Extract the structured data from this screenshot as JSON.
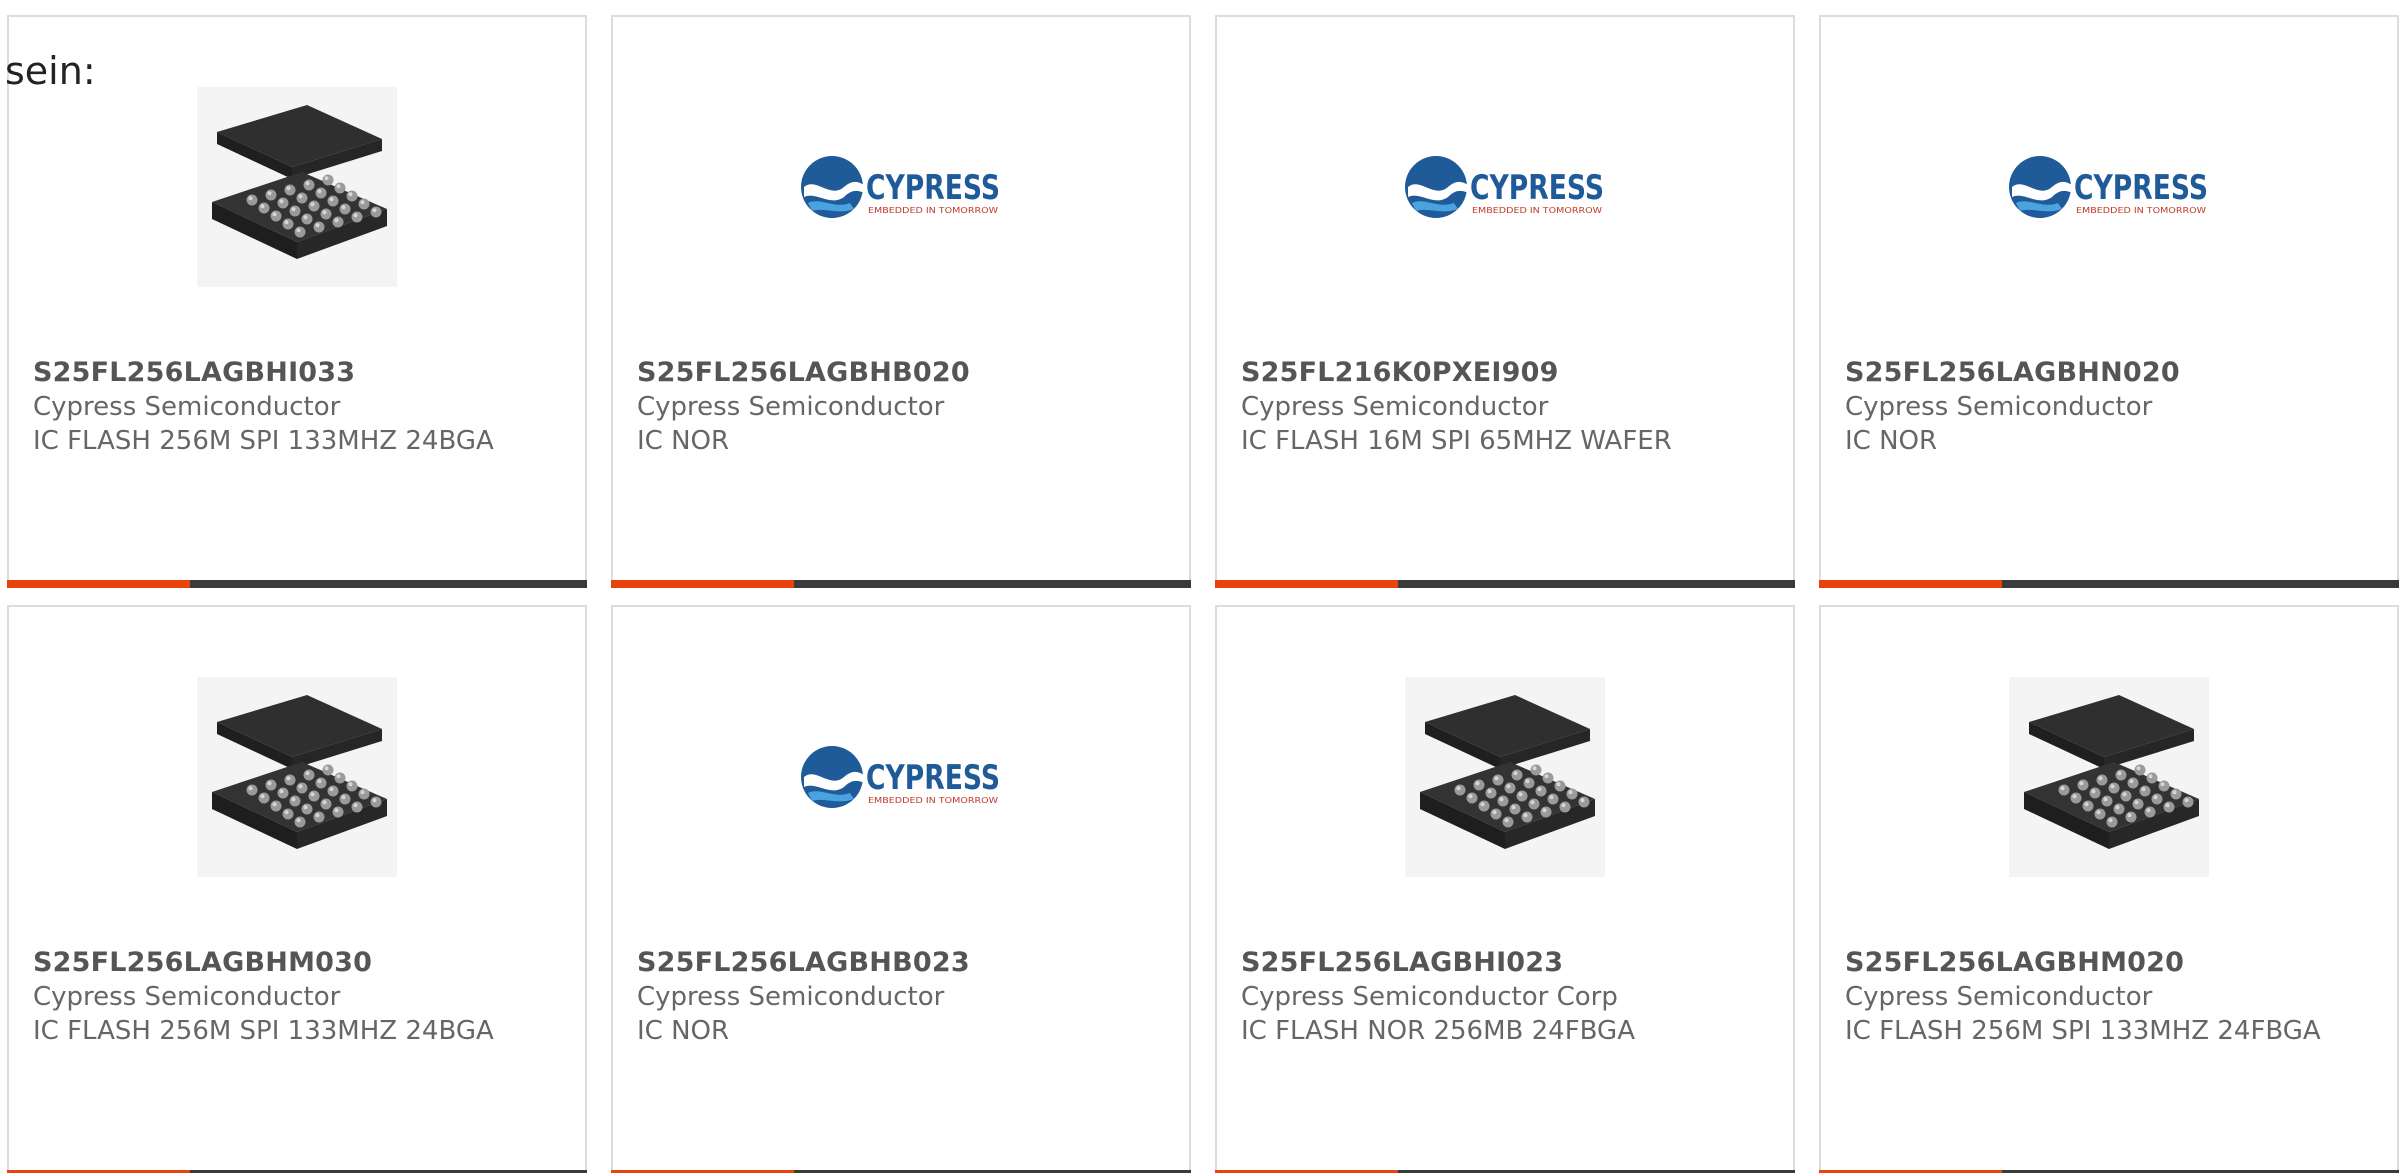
{
  "page": {
    "prefix_text": "sein:"
  },
  "colors": {
    "bar_accent": "#e8430c",
    "bar_rest": "#3a3a3a",
    "card_border": "#dcdcdc",
    "text_gray": "#666666",
    "cypress_blue": "#1f5a99"
  },
  "cards": [
    {
      "part_number": "S25FL256LAGBHI033",
      "manufacturer": "Cypress Semiconductor",
      "description": "IC FLASH 256M SPI 133MHZ 24BGA",
      "image_type": "chip-exploded"
    },
    {
      "part_number": "S25FL256LAGBHB020",
      "manufacturer": "Cypress Semiconductor",
      "description": "IC NOR",
      "image_type": "cypress-logo"
    },
    {
      "part_number": "S25FL216K0PXEI909",
      "manufacturer": "Cypress Semiconductor",
      "description": "IC FLASH 16M SPI 65MHZ WAFER",
      "image_type": "cypress-logo"
    },
    {
      "part_number": "S25FL256LAGBHN020",
      "manufacturer": "Cypress Semiconductor",
      "description": "IC NOR",
      "image_type": "cypress-logo"
    },
    {
      "part_number": "S25FL256LAGBHM030",
      "manufacturer": "Cypress Semiconductor",
      "description": "IC FLASH 256M SPI 133MHZ 24BGA",
      "image_type": "chip-exploded"
    },
    {
      "part_number": "S25FL256LAGBHB023",
      "manufacturer": "Cypress Semiconductor",
      "description": "IC NOR",
      "image_type": "cypress-logo"
    },
    {
      "part_number": "S25FL256LAGBHI023",
      "manufacturer": "Cypress Semiconductor Corp",
      "description": "IC FLASH NOR 256MB 24FBGA",
      "image_type": "chip-exploded"
    },
    {
      "part_number": "S25FL256LAGBHM020",
      "manufacturer": "Cypress Semiconductor",
      "description": "IC FLASH 256M SPI 133MHZ 24FBGA",
      "image_type": "chip-exploded"
    }
  ],
  "cypress_logo": {
    "wordmark": "CYPRESS",
    "tagline": "EMBEDDED IN TOMORROW"
  }
}
